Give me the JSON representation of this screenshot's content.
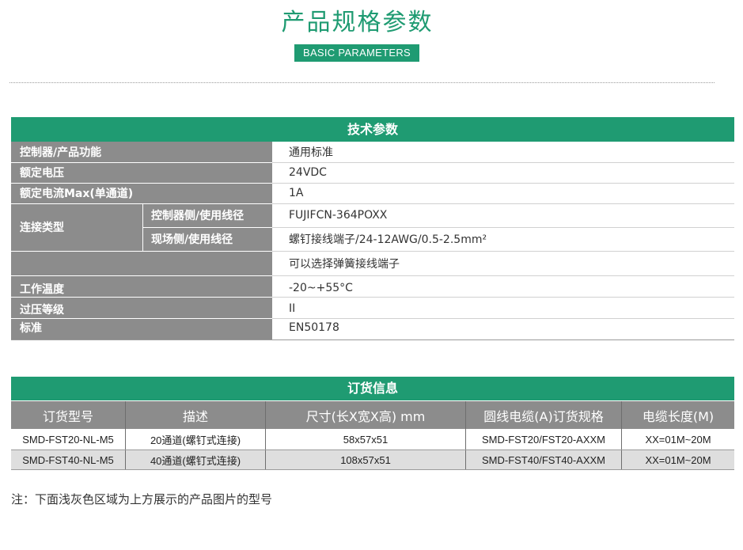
{
  "header": {
    "title": "产品规格参数",
    "subtitle": "BASIC PARAMETERS"
  },
  "tech": {
    "heading": "技术参数",
    "rows": [
      {
        "label": "控制器/产品功能",
        "value": "通用标准"
      },
      {
        "label": "额定电压",
        "value": "24VDC"
      },
      {
        "label": "额定电流Max(单通道)",
        "value": "1A"
      }
    ],
    "connection": {
      "label": "连接类型",
      "controller_side_label": "控制器侧/使用线径",
      "controller_side_value": "FUJIFCN-364POXX",
      "field_side_label": "现场侧/使用线径",
      "field_side_value": "螺钉接线端子/24-12AWG/0.5-2.5mm²",
      "extra_value": "可以选择弹簧接线端子"
    },
    "rows2": [
      {
        "label": "工作温度",
        "value": "-20~+55°C"
      },
      {
        "label": "过压等级",
        "value": "II"
      },
      {
        "label": "标准",
        "value": "EN50178"
      }
    ]
  },
  "order": {
    "heading": "订货信息",
    "columns": [
      "订货型号",
      "描述",
      "尺寸(长X宽X高) mm",
      "圆线电缆(A)订货规格",
      "电缆长度(M)"
    ],
    "rows": [
      [
        "SMD-FST20-NL-M5",
        "20通道(螺钉式连接)",
        "58x57x51",
        "SMD-FST20/FST20-AXXM",
        "XX=01M~20M"
      ],
      [
        "SMD-FST40-NL-M5",
        "40通道(螺钉式连接)",
        "108x57x51",
        "SMD-FST40/FST40-AXXM",
        "XX=01M~20M"
      ]
    ]
  },
  "note": "注：下面浅灰色区域为上方展示的产品图片的型号",
  "colors": {
    "accent": "#1f9b72",
    "label_bg": "#8c8c8c",
    "row_alt": "#dedede"
  }
}
